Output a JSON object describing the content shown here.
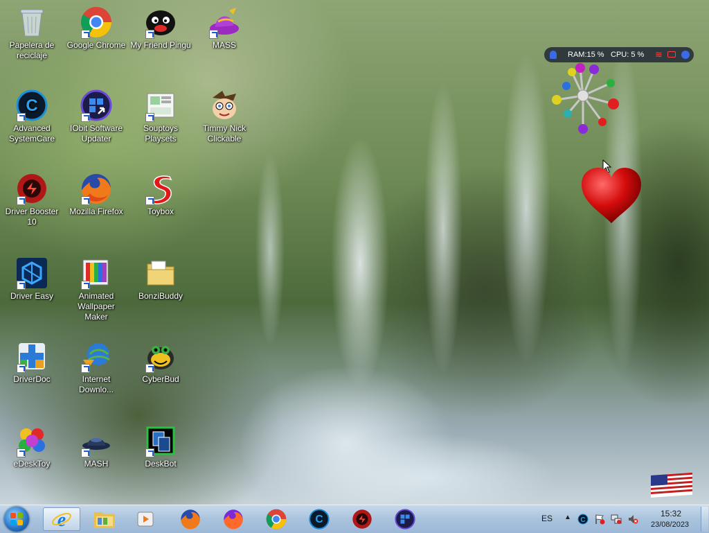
{
  "desktop": {
    "icons": [
      {
        "label": "Papelera de reciclaje",
        "icon": "recycle-bin-icon"
      },
      {
        "label": "Google Chrome",
        "icon": "chrome-icon"
      },
      {
        "label": "My Friend Pingu",
        "icon": "pingu-icon"
      },
      {
        "label": "MASS",
        "icon": "mass-hat-icon"
      },
      {
        "label": "Advanced SystemCare",
        "icon": "advanced-systemcare-icon"
      },
      {
        "label": "IObit Software Updater",
        "icon": "iobit-updater-icon"
      },
      {
        "label": "Souptoys Playsets",
        "icon": "souptoys-icon"
      },
      {
        "label": "Timmy Nick Clickable",
        "icon": "timmy-icon"
      },
      {
        "label": "Driver Booster 10",
        "icon": "driver-booster-icon"
      },
      {
        "label": "Mozilla Firefox",
        "icon": "firefox-icon"
      },
      {
        "label": "Toybox",
        "icon": "toybox-icon"
      },
      {
        "label": "Driver Easy",
        "icon": "driver-easy-icon"
      },
      {
        "label": "Animated Wallpaper Maker",
        "icon": "wallpaper-maker-icon"
      },
      {
        "label": "BonziBuddy",
        "icon": "folder-icon"
      },
      {
        "label": "DriverDoc",
        "icon": "driverdoc-icon"
      },
      {
        "label": "Internet Downlo...",
        "icon": "internet-download-icon"
      },
      {
        "label": "CyberBud",
        "icon": "cyberbud-icon"
      },
      {
        "label": "eDeskToy",
        "icon": "edesktoy-icon"
      },
      {
        "label": "MASH",
        "icon": "mash-icon"
      },
      {
        "label": "DeskBot",
        "icon": "deskbot-icon"
      }
    ]
  },
  "sysmon": {
    "ram": "RAM:15 %",
    "cpu": "CPU: 5 %"
  },
  "taskbar": {
    "pinned": [
      "internet-explorer-icon",
      "file-explorer-icon",
      "media-player-icon",
      "firefox-icon",
      "firefox-icon",
      "chrome-icon",
      "advanced-systemcare-icon",
      "driver-booster-icon",
      "iobit-updater-icon"
    ],
    "language": "ES",
    "time": "15:32",
    "date": "23/08/2023"
  },
  "colors": {
    "taskbar": "#a9c3dd",
    "sysmon_bg": "#141a2d",
    "heart": "#d40c0c"
  }
}
